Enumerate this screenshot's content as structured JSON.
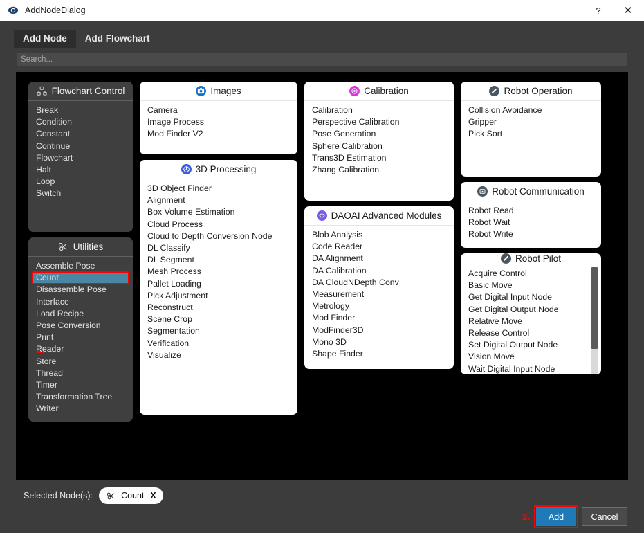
{
  "window": {
    "title": "AddNodeDialog",
    "app_icon": "app-logo-icon",
    "help_label": "?",
    "close_label": "✕"
  },
  "tabs": [
    {
      "label": "Add Node",
      "active": true
    },
    {
      "label": "Add Flowchart",
      "active": false
    }
  ],
  "search": {
    "placeholder": "Search...",
    "value": ""
  },
  "annotations": {
    "step1": "1.",
    "step2": "2."
  },
  "colors": {
    "accent_blue": "#1e7bb8",
    "selection": "#4a87a5",
    "annotation_red": "#ff0000",
    "images_icon": "#1a73c8",
    "processing_icon": "#3d5ce0",
    "calibration_icon": "#d63ad6",
    "daoai_icon": "#7b5ce0",
    "robot_icon": "#4a5560"
  },
  "groups": [
    {
      "id": "flowchart-control",
      "title": "Flowchart Control",
      "icon": "org-chart-icon",
      "theme": "dark",
      "items": [
        "Break",
        "Condition",
        "Constant",
        "Continue",
        "Flowchart",
        "Halt",
        "Loop",
        "Switch"
      ]
    },
    {
      "id": "utilities",
      "title": "Utilities",
      "icon": "wrench-icon",
      "theme": "dark",
      "selected": "Count",
      "items": [
        "Assemble Pose",
        "Count",
        "Disassemble Pose",
        "Interface",
        "Load Recipe",
        "Pose Conversion",
        "Print",
        "Reader",
        "Store",
        "Thread",
        "Timer",
        "Transformation Tree",
        "Writer"
      ]
    },
    {
      "id": "images",
      "title": "Images",
      "icon": "camera-icon",
      "theme": "light",
      "items": [
        "Camera",
        "Image Process",
        "Mod Finder V2"
      ]
    },
    {
      "id": "3d-processing",
      "title": "3D Processing",
      "icon": "cube-icon",
      "theme": "light",
      "items": [
        "3D Object Finder",
        "Alignment",
        "Box Volume Estimation",
        "Cloud Process",
        "Cloud to Depth Conversion Node",
        "DL Classify",
        "DL Segment",
        "Mesh Process",
        "Pallet Loading",
        "Pick Adjustment",
        "Reconstruct",
        "Scene Crop",
        "Segmentation",
        "Verification",
        "Visualize"
      ]
    },
    {
      "id": "calibration",
      "title": "Calibration",
      "icon": "target-icon",
      "theme": "light",
      "items": [
        "Calibration",
        "Perspective Calibration",
        "Pose Generation",
        "Sphere Calibration",
        "Trans3D Estimation",
        "Zhang Calibration"
      ]
    },
    {
      "id": "daoai-advanced-modules",
      "title": "DAOAI Advanced Modules",
      "icon": "code-brackets-icon",
      "theme": "light",
      "items": [
        "Blob Analysis",
        "Code Reader",
        "DA Alignment",
        "DA Calibration",
        "DA CloudNDepth Conv",
        "Measurement",
        "Metrology",
        "Mod Finder",
        "ModFinder3D",
        "Mono 3D",
        "Shape Finder"
      ]
    },
    {
      "id": "robot-operation",
      "title": "Robot Operation",
      "icon": "robot-arm-icon",
      "theme": "light",
      "items": [
        "Collision Avoidance",
        "Gripper",
        "Pick Sort"
      ]
    },
    {
      "id": "robot-communication",
      "title": "Robot Communication",
      "icon": "signal-icon",
      "theme": "light",
      "items": [
        "Robot Read",
        "Robot Wait",
        "Robot Write"
      ]
    },
    {
      "id": "robot-pilot",
      "title": "Robot Pilot",
      "icon": "robot-arm-icon",
      "theme": "light",
      "scrollable": true,
      "items": [
        "Acquire Control",
        "Basic Move",
        "Get Digital Input Node",
        "Get Digital Output Node",
        "Relative Move",
        "Release Control",
        "Set Digital Output Node",
        "Vision Move",
        "Wait Digital Input Node"
      ]
    }
  ],
  "footer": {
    "selected_label": "Selected Node(s):",
    "chips": [
      {
        "label": "Count",
        "icon": "wrench-icon",
        "remove_label": "X"
      }
    ],
    "add_label": "Add",
    "cancel_label": "Cancel"
  }
}
